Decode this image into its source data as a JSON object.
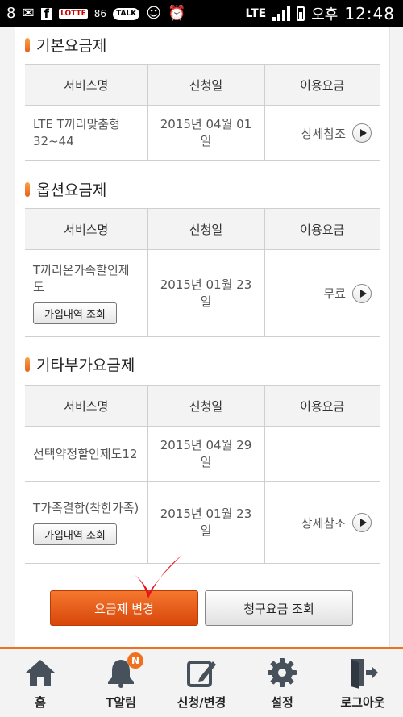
{
  "status_bar": {
    "left_icons": [
      "8-icon",
      "mail-icon",
      "facebook-icon",
      "lotte-icon",
      "86-app-icon",
      "talk-icon",
      "frog-icon",
      "alarm-icon"
    ],
    "lotte_label": "LOTTE",
    "app_badge": "86",
    "talk_label": "TALK",
    "network": "LTE",
    "ampm": "오후",
    "time": "12:48"
  },
  "sections": {
    "basic": {
      "title": "기본요금제",
      "headers": [
        "서비스명",
        "신청일",
        "이용요금"
      ],
      "rows": [
        {
          "name": "LTE T끼리맞춤형32~44",
          "date": "2015년 04월 01일",
          "fee": "상세참조"
        }
      ]
    },
    "option": {
      "title": "옵션요금제",
      "headers": [
        "서비스명",
        "신청일",
        "이용요금"
      ],
      "rows": [
        {
          "name": "T끼리온가족할인제도",
          "button": "가입내역 조회",
          "date": "2015년 01월 23일",
          "fee": "무료"
        }
      ]
    },
    "other": {
      "title": "기타부가요금제",
      "headers": [
        "서비스명",
        "신청일",
        "이용요금"
      ],
      "rows": [
        {
          "name": "선택약정할인제도12",
          "date": "2015년 04월 29일",
          "fee": ""
        },
        {
          "name": "T가족결합(착한가족)",
          "button": "가입내역 조회",
          "date": "2015년 01월 23일",
          "fee": "상세참조"
        }
      ]
    }
  },
  "actions": {
    "change_plan": "요금제 변경",
    "billing_query": "청구요금 조회"
  },
  "tabbar": {
    "items": [
      {
        "label": "홈",
        "icon": "home-icon"
      },
      {
        "label": "T알림",
        "icon": "bell-icon",
        "badge": "N"
      },
      {
        "label": "신청/변경",
        "icon": "edit-icon"
      },
      {
        "label": "설정",
        "icon": "gear-icon"
      },
      {
        "label": "로그아웃",
        "icon": "logout-icon"
      }
    ]
  },
  "colors": {
    "accent": "#f07022",
    "button_orange": "#e35a14"
  }
}
